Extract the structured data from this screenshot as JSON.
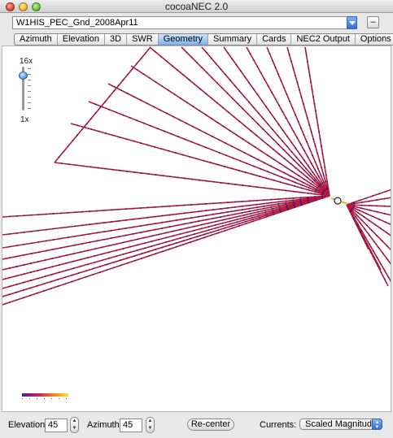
{
  "window": {
    "title": "cocoaNEC 2.0"
  },
  "file_selector": {
    "value": "W1HIS_PEC_Gnd_2008Apr11",
    "minus_label": "–"
  },
  "tabs": [
    {
      "label": "Azimuth"
    },
    {
      "label": "Elevation"
    },
    {
      "label": "3D"
    },
    {
      "label": "SWR"
    },
    {
      "label": "Geometry",
      "active": true
    },
    {
      "label": "Summary"
    },
    {
      "label": "Cards"
    },
    {
      "label": "NEC2 Output"
    },
    {
      "label": "Options"
    }
  ],
  "zoom": {
    "max_label": "16x",
    "min_label": "1x"
  },
  "controls": {
    "elevation_label": "Elevation",
    "elevation_value": "45",
    "azimuth_label": "Azimuth",
    "azimuth_value": "45",
    "recenter_label": "Re-center",
    "currents_label": "Currents:",
    "currents_value": "Scaled Magnitude"
  },
  "colors": {
    "wire": "#b3183f",
    "segment_dot": "#3a1a6a",
    "feed": "#d8c02a",
    "accent": "#3a7ee0"
  }
}
